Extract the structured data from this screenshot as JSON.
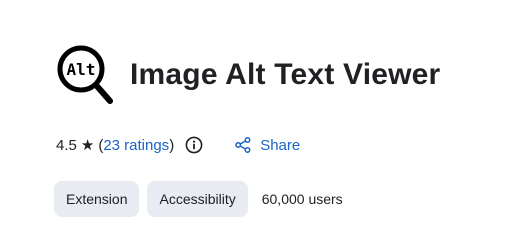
{
  "extension": {
    "logo_text": "Alt",
    "logo_icon": "magnifier-alt-icon",
    "name": "Image Alt Text Viewer"
  },
  "rating": {
    "value": "4.5",
    "star": "★",
    "open_paren": "(",
    "count_label": "23 ratings",
    "close_paren": ")",
    "info_icon": "info-icon"
  },
  "share": {
    "label": "Share",
    "icon": "share-icon"
  },
  "tags": [
    {
      "label": "Extension"
    },
    {
      "label": "Accessibility"
    }
  ],
  "users": "60,000 users",
  "colors": {
    "text": "#202124",
    "link": "#1a63c7",
    "chip_bg": "#e8ecf2"
  }
}
